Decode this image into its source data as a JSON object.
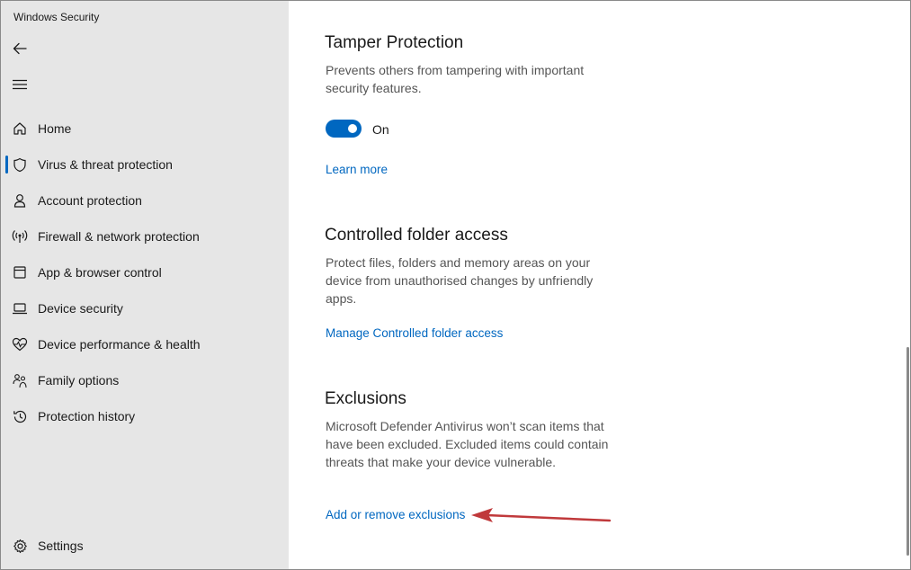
{
  "window": {
    "title": "Windows Security"
  },
  "sidebar": {
    "items": [
      {
        "label": "Home",
        "icon": "home-icon"
      },
      {
        "label": "Virus & threat protection",
        "icon": "shield-icon",
        "selected": true
      },
      {
        "label": "Account protection",
        "icon": "person-icon"
      },
      {
        "label": "Firewall & network protection",
        "icon": "wifi-antenna-icon"
      },
      {
        "label": "App & browser control",
        "icon": "browser-window-icon"
      },
      {
        "label": "Device security",
        "icon": "laptop-icon"
      },
      {
        "label": "Device performance & health",
        "icon": "heart-pulse-icon"
      },
      {
        "label": "Family options",
        "icon": "family-icon"
      },
      {
        "label": "Protection history",
        "icon": "history-icon"
      }
    ],
    "settings_label": "Settings"
  },
  "main": {
    "tamper": {
      "title": "Tamper Protection",
      "description": "Prevents others from tampering with important security features.",
      "toggle_state": "On",
      "link": "Learn more"
    },
    "cfa": {
      "title": "Controlled folder access",
      "description": "Protect files, folders and memory areas on your device from unauthorised changes by unfriendly apps.",
      "link": "Manage Controlled folder access"
    },
    "exclusions": {
      "title": "Exclusions",
      "description": "Microsoft Defender Antivirus won’t scan items that have been excluded. Excluded items could contain threats that make your device vulnerable.",
      "link": "Add or remove exclusions"
    }
  },
  "colors": {
    "accent": "#0067c0",
    "sidebar_bg": "#e6e6e6",
    "annotation_arrow": "#c0393b"
  }
}
